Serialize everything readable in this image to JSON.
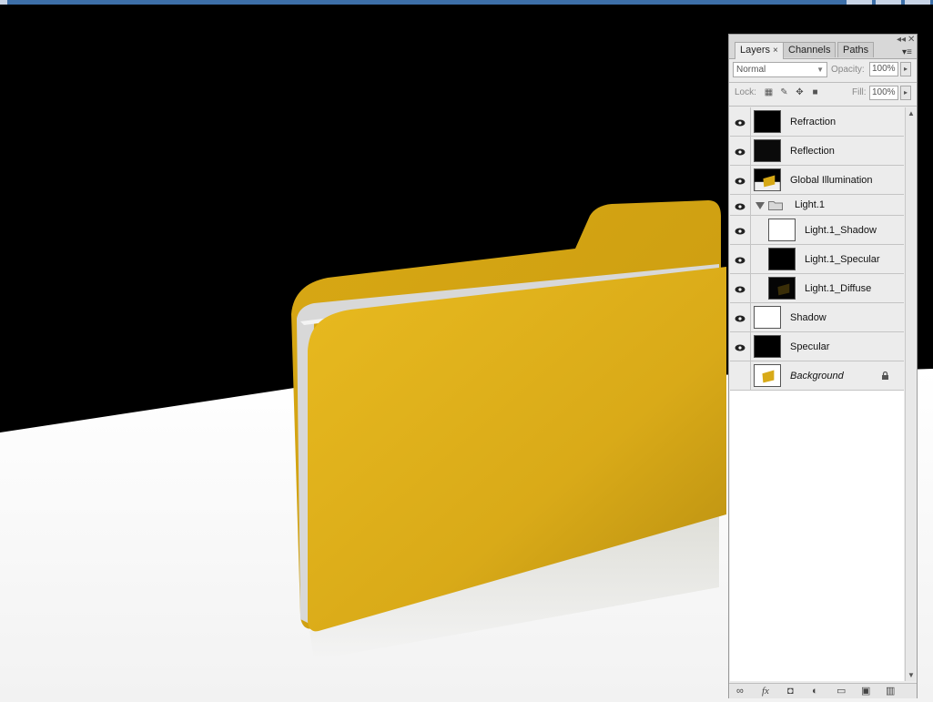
{
  "panel": {
    "tabs": [
      {
        "label": "Layers",
        "close": "×"
      },
      {
        "label": "Channels"
      },
      {
        "label": "Paths"
      }
    ],
    "collapse_glyph": "◂◂",
    "close_glyph": "✕",
    "menu_glyph": "▾≡",
    "blend_mode": "Normal",
    "opacity_label": "Opacity:",
    "opacity_value": "100%",
    "lock_label": "Lock:",
    "fill_label": "Fill:",
    "fill_value": "100%"
  },
  "layers": [
    {
      "name": "Refraction",
      "visible": true,
      "thumb": "black",
      "indent": 0
    },
    {
      "name": "Reflection",
      "visible": true,
      "thumb": "dark",
      "indent": 0
    },
    {
      "name": "Global Illumination",
      "visible": true,
      "thumb": "folder-scene",
      "indent": 0
    },
    {
      "name": "Light.1",
      "visible": true,
      "type": "group",
      "indent": 0
    },
    {
      "name": "Light.1_Shadow",
      "visible": true,
      "thumb": "white",
      "indent": 1
    },
    {
      "name": "Light.1_Specular",
      "visible": true,
      "thumb": "black",
      "indent": 1
    },
    {
      "name": "Light.1_Diffuse",
      "visible": true,
      "thumb": "dark-folder",
      "indent": 1
    },
    {
      "name": "Shadow",
      "visible": true,
      "thumb": "white",
      "indent": 0
    },
    {
      "name": "Specular",
      "visible": true,
      "thumb": "black",
      "indent": 0
    },
    {
      "name": "Background",
      "visible": false,
      "thumb": "folder-white",
      "indent": 0,
      "italic": true,
      "locked": true
    }
  ],
  "colors": {
    "folder_yellow": "#e0b21c",
    "folder_shade": "#b08a10",
    "floor": "#f4f4f4",
    "panel_bg": "#ececec"
  }
}
